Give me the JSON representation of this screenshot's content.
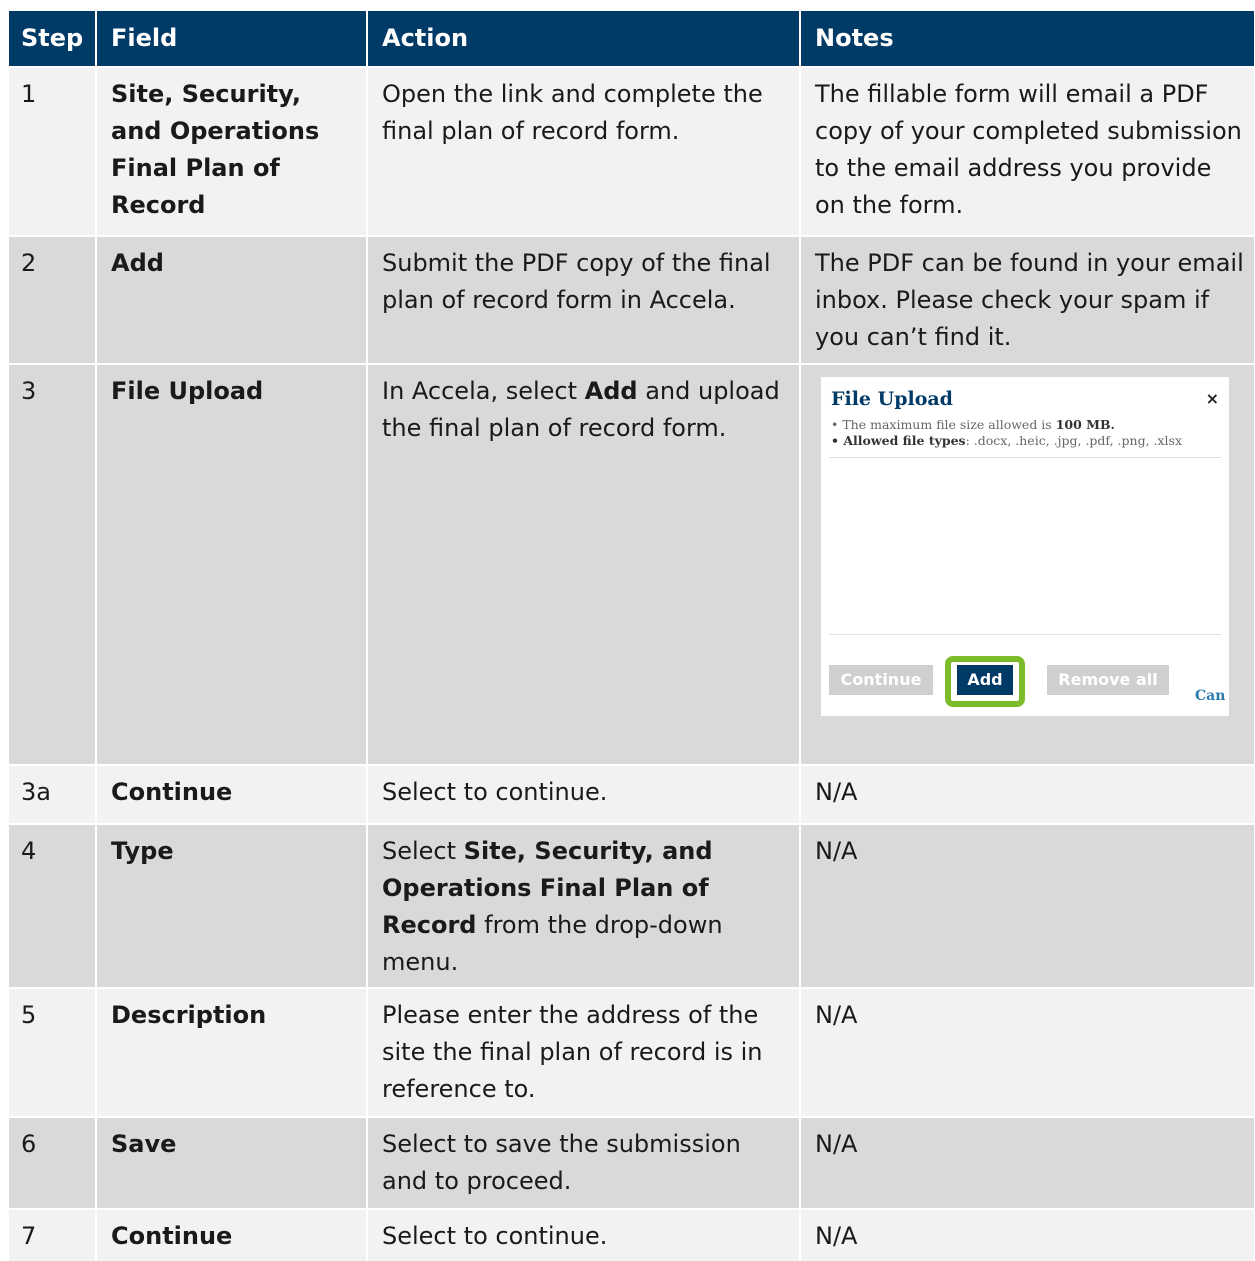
{
  "headers": [
    "Step",
    "Field",
    "Action",
    "Notes"
  ],
  "rows": [
    {
      "step": "1",
      "field": "Site, Security, and Operations Final Plan of Record",
      "action": "Open the link and complete the final plan of record form.",
      "notes": "The fillable form will email a PDF copy of your completed submission to the email address you provide on the form."
    },
    {
      "step": "2",
      "field": "Add",
      "action": "Submit the PDF copy of the final plan of record form in Accela.",
      "notes": "The PDF can be found in your email inbox. Please check your spam if you can’t find it."
    },
    {
      "step": "3",
      "field": "File Upload",
      "action_pre": "In Accela, select ",
      "action_bold": "Add",
      "action_post": " and upload the final plan of record form."
    },
    {
      "step": "3a",
      "field": "Continue",
      "action": "Select to continue.",
      "notes": "N/A"
    },
    {
      "step": "4",
      "field": "Type",
      "action_pre": "Select ",
      "action_bold": "Site, Security, and Operations Final Plan of Record",
      "action_post": " from the drop-down menu.",
      "notes": "N/A"
    },
    {
      "step": "5",
      "field": "Description",
      "action": "Please enter the address of the site the final plan of record is in reference to.",
      "notes": "N/A"
    },
    {
      "step": "6",
      "field": "Save",
      "action": "Select to save the submission and to proceed.",
      "notes": "N/A"
    },
    {
      "step": "7",
      "field": "Continue",
      "action": "Select to continue.",
      "notes": "N/A"
    }
  ],
  "dialog": {
    "title": "File Upload",
    "close_icon": "×",
    "line1_pre": "• The maximum file size allowed is ",
    "line1_bold": "100 MB.",
    "line2_bold": "• Allowed file types",
    "line2_post": ": .docx, .heic, .jpg, .pdf, .png, .xlsx",
    "continue_label": "Continue",
    "add_label": "Add",
    "remove_label": "Remove all",
    "cancel_label": "Can",
    "highlight_color": "#7cbc2b"
  },
  "colors": {
    "header_bg": "#003a66",
    "row_light": "#f2f2f2",
    "row_dark": "#d9d9d9"
  }
}
